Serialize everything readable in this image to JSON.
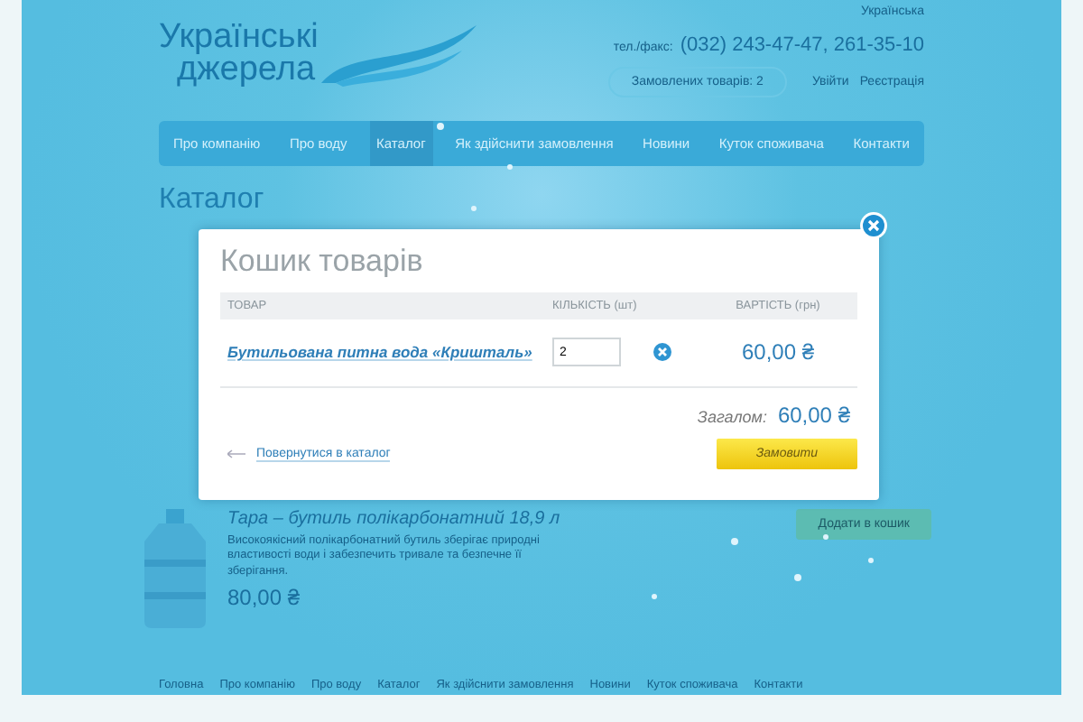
{
  "logo": {
    "line_1": "Українські",
    "line_2": "джерела"
  },
  "language": "Українська",
  "phone_label": "тел./факс:",
  "phone": "(032) 243-47-47, 261-35-10",
  "cart_summary": "Замовлених товарів: 2",
  "auth_links": [
    "Увійти",
    "Реєстрація"
  ],
  "nav": [
    {
      "label": "Про компанію",
      "selected": false
    },
    {
      "label": "Про воду",
      "selected": false
    },
    {
      "label": "Каталог",
      "selected": true
    },
    {
      "label": "Як здійснити замовлення",
      "selected": false
    },
    {
      "label": "Новини",
      "selected": false
    },
    {
      "label": "Куток споживача",
      "selected": false
    },
    {
      "label": "Контакти",
      "selected": false
    }
  ],
  "page_title": "Каталог",
  "background_product": {
    "title": "Тара – бутиль полікарбонатний 18,9 л",
    "description": "Високоякісний полікарбонатний бутиль зберігає природні властивості води і забезпечить тривале та безпечне її зберігання.",
    "price": "80,00 ₴",
    "button": "Додати в кошик"
  },
  "cart_dialog": {
    "title": "Кошик товарів",
    "columns": [
      "ТОВАР",
      "КІЛЬКІСТЬ (шт)",
      "ВАРТІСТЬ (грн)"
    ],
    "rows": [
      {
        "name": "Бутильована питна вода «Кришталь»",
        "quantity": "2",
        "price": "60,00 ₴"
      }
    ],
    "total_label": "Загалом:",
    "total": "60,00 ₴",
    "back_link": "Повернутися в каталог",
    "order_button": "Замовити"
  },
  "footer_links": [
    "Головна",
    "Про компанію",
    "Про воду",
    "Каталог",
    "Як здійснити замовлення",
    "Новини",
    "Куток споживача",
    "Контакти"
  ]
}
